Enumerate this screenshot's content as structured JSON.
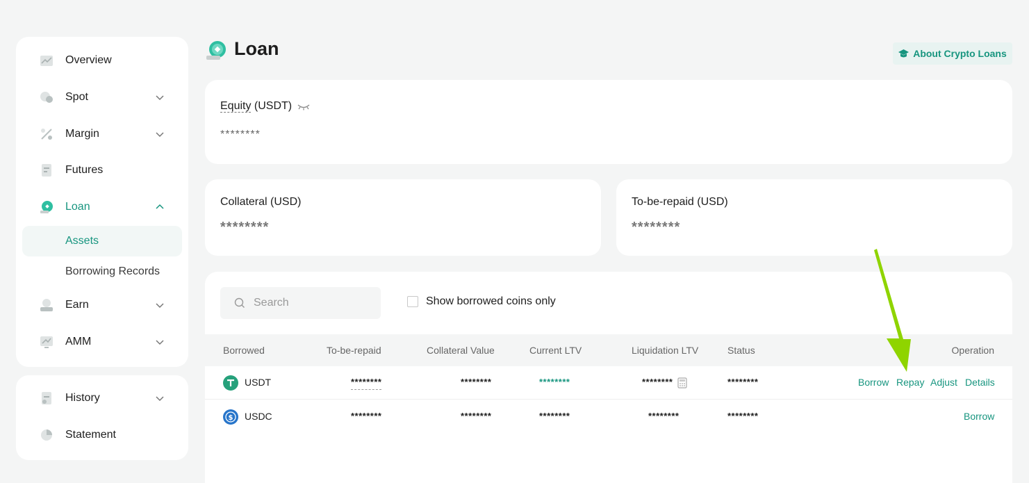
{
  "sidebar": {
    "items": [
      {
        "label": "Overview",
        "icon": "chart-icon"
      },
      {
        "label": "Spot",
        "icon": "coins-icon"
      },
      {
        "label": "Margin",
        "icon": "percent-icon"
      },
      {
        "label": "Futures",
        "icon": "document-icon"
      },
      {
        "label": "Loan",
        "icon": "loan-icon"
      },
      {
        "label": "Earn",
        "icon": "earn-icon"
      },
      {
        "label": "AMM",
        "icon": "amm-icon"
      }
    ],
    "loan_sub": [
      {
        "label": "Assets",
        "active": true
      },
      {
        "label": "Borrowing Records",
        "active": false
      }
    ],
    "bottom": [
      {
        "label": "History",
        "icon": "history-icon"
      },
      {
        "label": "Statement",
        "icon": "statement-icon"
      }
    ]
  },
  "header": {
    "title": "Loan",
    "about_label": "About Crypto Loans"
  },
  "equity": {
    "label": "Equity",
    "unit": "(USDT)",
    "value": "********"
  },
  "collateral": {
    "label": "Collateral (USD)",
    "value": "********"
  },
  "to_be_repaid": {
    "label": "To-be-repaid (USD)",
    "value": "********"
  },
  "table": {
    "search_placeholder": "Search",
    "checkbox_label": "Show borrowed coins only",
    "headers": [
      "Borrowed",
      "To-be-repaid",
      "Collateral Value",
      "Current LTV",
      "Liquidation LTV",
      "Status",
      "Operation"
    ],
    "rows": [
      {
        "coin": "USDT",
        "to_be_repaid": "********",
        "collateral_value": "********",
        "current_ltv": "********",
        "liquidation_ltv": "********",
        "status": "********",
        "ops": [
          "Borrow",
          "Repay",
          "Adjust",
          "Details"
        ]
      },
      {
        "coin": "USDC",
        "to_be_repaid": "********",
        "collateral_value": "********",
        "current_ltv": "********",
        "liquidation_ltv": "********",
        "status": "********",
        "ops": [
          "Borrow"
        ]
      }
    ]
  },
  "colors": {
    "accent": "#17957f",
    "annotation_arrow": "#8fd400",
    "usdt": "#26a17b",
    "usdc": "#2775ca"
  }
}
